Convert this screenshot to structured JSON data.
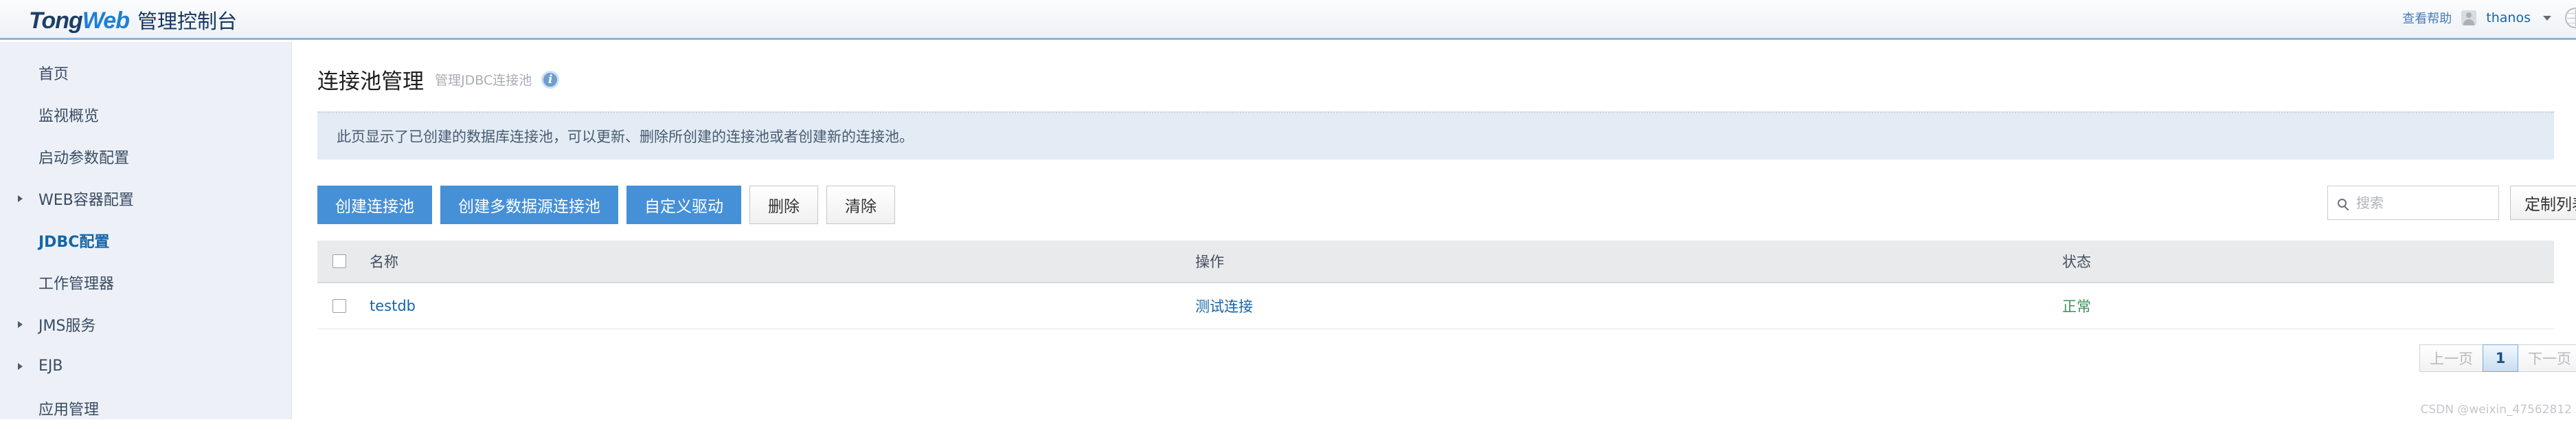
{
  "header": {
    "logo_tong": "Tong",
    "logo_web": "Web",
    "logo_suffix": "管理控制台",
    "help_label": "查看帮助",
    "user_name": "thanos"
  },
  "sidebar": {
    "items": [
      {
        "label": "首页",
        "expandable": false,
        "active": false
      },
      {
        "label": "监视概览",
        "expandable": false,
        "active": false
      },
      {
        "label": "启动参数配置",
        "expandable": false,
        "active": false
      },
      {
        "label": "WEB容器配置",
        "expandable": true,
        "active": false
      },
      {
        "label": "JDBC配置",
        "expandable": false,
        "active": true
      },
      {
        "label": "工作管理器",
        "expandable": false,
        "active": false
      },
      {
        "label": "JMS服务",
        "expandable": true,
        "active": false
      },
      {
        "label": "EJB",
        "expandable": true,
        "active": false
      },
      {
        "label": "应用管理",
        "expandable": false,
        "active": false
      }
    ]
  },
  "page": {
    "title": "连接池管理",
    "subtitle": "管理JDBC连接池",
    "info_glyph": "i",
    "notice": "此页显示了已创建的数据库连接池，可以更新、删除所创建的连接池或者创建新的连接池。"
  },
  "toolbar": {
    "create_pool": "创建连接池",
    "create_multi_pool": "创建多数据源连接池",
    "custom_driver": "自定义驱动",
    "delete": "删除",
    "clear": "清除",
    "search_placeholder": "搜索",
    "search_value": "",
    "custom_list": "定制列表"
  },
  "table": {
    "columns": [
      "",
      "名称",
      "操作",
      "状态"
    ],
    "rows": [
      {
        "name": "testdb",
        "action": "测试连接",
        "status": "正常"
      }
    ]
  },
  "pagination": {
    "prev": "上一页",
    "current": "1",
    "next": "下一页"
  },
  "watermark": "CSDN @weixin_47562812",
  "colors": {
    "primary_button": "#4690d8",
    "link": "#1565a8",
    "status_ok": "#3f8f5a",
    "sidebar_bg": "#edf1f7",
    "notice_bg": "#e3ebf5"
  }
}
